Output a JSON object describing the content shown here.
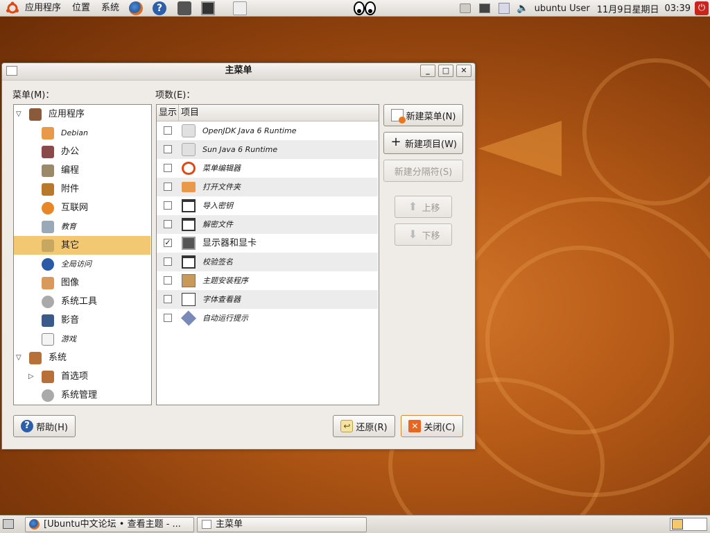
{
  "top_panel": {
    "menus": [
      "应用程序",
      "位置",
      "系统"
    ],
    "user": "ubuntu User",
    "date": "11月9日星期日",
    "time": "03:39"
  },
  "window": {
    "title": "主菜单",
    "minimize": "_",
    "maximize": "□",
    "close": "✕"
  },
  "menus_label": "菜单(M)：",
  "items_label": "项数(E)：",
  "tree": [
    {
      "label": "应用程序",
      "level": 0,
      "expander": "▽",
      "icon": "applications-icon"
    },
    {
      "label": "Debian",
      "level": 1,
      "icon": "folder-icon",
      "small": true
    },
    {
      "label": "办公",
      "level": 1,
      "icon": "office-icon"
    },
    {
      "label": "编程",
      "level": 1,
      "icon": "programming-icon"
    },
    {
      "label": "附件",
      "level": 1,
      "icon": "accessories-icon"
    },
    {
      "label": "互联网",
      "level": 1,
      "icon": "internet-icon"
    },
    {
      "label": "教育",
      "level": 1,
      "icon": "education-icon",
      "small": true
    },
    {
      "label": "其它",
      "level": 1,
      "icon": "other-icon",
      "selected": true
    },
    {
      "label": "全局访问",
      "level": 1,
      "icon": "accessibility-icon",
      "small": true
    },
    {
      "label": "图像",
      "level": 1,
      "icon": "graphics-icon"
    },
    {
      "label": "系统工具",
      "level": 1,
      "icon": "system-tools-icon"
    },
    {
      "label": "影音",
      "level": 1,
      "icon": "multimedia-icon"
    },
    {
      "label": "游戏",
      "level": 1,
      "icon": "games-icon",
      "small": true
    },
    {
      "label": "系统",
      "level": 0,
      "expander": "▽",
      "icon": "system-icon"
    },
    {
      "label": "首选项",
      "level": 1,
      "expander": "▷",
      "icon": "preferences-icon"
    },
    {
      "label": "系统管理",
      "level": 1,
      "icon": "administration-icon"
    }
  ],
  "columns": {
    "show": "显示",
    "item": "项目"
  },
  "items": [
    {
      "label": "OpenJDK Java 6 Runtime",
      "checked": false,
      "icon": "java-icon"
    },
    {
      "label": "Sun Java 6 Runtime",
      "checked": false,
      "icon": "java-icon"
    },
    {
      "label": "菜单编辑器",
      "checked": false,
      "icon": "ubuntu-icon"
    },
    {
      "label": "打开文件夹",
      "checked": false,
      "icon": "folder-icon"
    },
    {
      "label": "导入密钥",
      "checked": false,
      "icon": "window-icon"
    },
    {
      "label": "解密文件",
      "checked": false,
      "icon": "window-icon"
    },
    {
      "label": "显示器和显卡",
      "checked": true,
      "icon": "display-icon",
      "normal": true
    },
    {
      "label": "校验签名",
      "checked": false,
      "icon": "window-icon"
    },
    {
      "label": "主题安装程序",
      "checked": false,
      "icon": "theme-installer-icon"
    },
    {
      "label": "字体查看器",
      "checked": false,
      "icon": "font-viewer-icon"
    },
    {
      "label": "自动运行提示",
      "checked": false,
      "icon": "autorun-icon"
    }
  ],
  "check_mark": "✓",
  "buttons": {
    "new_menu": "新建菜单(N)",
    "new_item": "新建项目(W)",
    "new_separator": "新建分隔符(S)",
    "move_up": "上移",
    "move_down": "下移",
    "help": "帮助(H)",
    "revert": "还原(R)",
    "close": "关闭(C)"
  },
  "taskbar": [
    {
      "label": "[Ubuntu中文论坛 • 查看主题 - ...",
      "icon": "firefox-icon"
    },
    {
      "label": "主菜单",
      "icon": "menu-editor-icon"
    }
  ],
  "colors": {
    "selection": "#f2c972",
    "panel": "#dcd8d2",
    "desktop": "#b55a17"
  }
}
